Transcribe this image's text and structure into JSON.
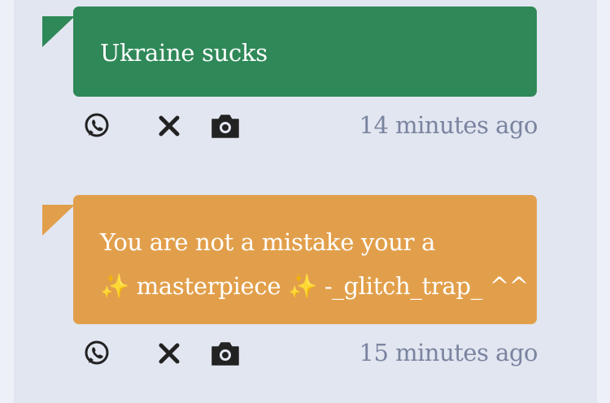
{
  "posts": [
    {
      "message": "Ukraine sucks",
      "color": "#2f8858",
      "time": "14 minutes ago",
      "actions": [
        "whatsapp-icon",
        "x-close-icon",
        "camera-icon"
      ]
    },
    {
      "message_line1": "You are not a mistake your a",
      "message_line2": "✨ masterpiece ✨ -_glitch_trap_ ^^",
      "color": "#e29f4b",
      "time": "15 minutes ago",
      "actions": [
        "whatsapp-icon",
        "x-close-icon",
        "camera-icon"
      ]
    }
  ]
}
